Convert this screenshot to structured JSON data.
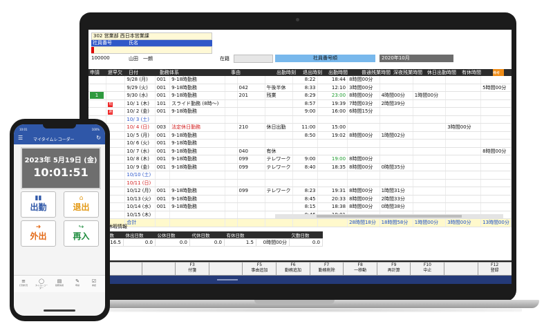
{
  "header": {
    "dept": "302 営業部 西日本営業課",
    "emp_no_label": "社員番号",
    "name_label": "氏名",
    "emp_no": "100000",
    "emp_name": "山田　一朗",
    "status_label": "在籍",
    "sort_button": "社員番号順",
    "month": "2020年10月"
  },
  "columns": {
    "shinsei": "申請",
    "chika": "遅早欠",
    "date": "日付",
    "kinmu": "勤務体系",
    "jiyu": "事由",
    "in": "出勤時刻",
    "out": "退出時刻",
    "work": "出勤時間",
    "ot": "普通残業時間",
    "late_ot": "深夜残業時間",
    "holiday": "休日出勤時間",
    "paid": "有休時間",
    "extra": "備考"
  },
  "rows": [
    {
      "tag": "",
      "red": "",
      "date": "9/28 (月)",
      "dc": "",
      "code": "001",
      "shift": "9-18時勤務",
      "sc": "",
      "rc": "",
      "reason": "",
      "in": "8:22",
      "out": "18:44",
      "oc": "",
      "work": "8時間00分",
      "ot": "",
      "late": "",
      "hol": "",
      "paid": ""
    },
    {
      "tag": "",
      "red": "",
      "date": "9/29 (火)",
      "dc": "",
      "code": "001",
      "shift": "9-18時勤務",
      "sc": "",
      "rc": "042",
      "reason": "午後半休",
      "in": "8:33",
      "out": "12:10",
      "oc": "",
      "work": "3時間00分",
      "ot": "",
      "late": "",
      "hol": "",
      "paid": "5時間00分"
    },
    {
      "tag": "1",
      "red": "",
      "date": "9/30 (水)",
      "dc": "",
      "code": "001",
      "shift": "9-18時勤務",
      "sc": "",
      "rc": "201",
      "reason": "残業",
      "in": "8:29",
      "out": "23:00",
      "oc": "green",
      "work": "8時間00分",
      "ot": "4時間00分",
      "late": "1時間00分",
      "hol": "",
      "paid": ""
    },
    {
      "tag": "",
      "red": "有",
      "date": "10/ 1 (木)",
      "dc": "",
      "code": "101",
      "shift": "スライド勤務 (8時～)",
      "sc": "",
      "rc": "",
      "reason": "",
      "in": "8:57",
      "out": "19:39",
      "oc": "",
      "work": "7時間03分",
      "ot": "2時間39分",
      "late": "",
      "hol": "",
      "paid": ""
    },
    {
      "tag": "",
      "red": "遅",
      "date": "10/ 2 (金)",
      "dc": "",
      "code": "001",
      "shift": "9-18時勤務",
      "sc": "",
      "rc": "",
      "reason": "",
      "in": "9:00",
      "out": "16:00",
      "oc": "",
      "work": "6時間15分",
      "ot": "",
      "late": "",
      "hol": "",
      "paid": ""
    },
    {
      "tag": "",
      "red": "",
      "date": "10/ 3 (土)",
      "dc": "sat",
      "code": "",
      "shift": "",
      "sc": "",
      "rc": "",
      "reason": "",
      "in": "",
      "out": "",
      "oc": "",
      "work": "",
      "ot": "",
      "late": "",
      "hol": "",
      "paid": ""
    },
    {
      "tag": "",
      "red": "",
      "date": "10/ 4 (日)",
      "dc": "sun",
      "code": "003",
      "shift": "法定休日勤務",
      "sc": "sun",
      "rc": "210",
      "reason": "休日出勤",
      "in": "11:00",
      "out": "15:00",
      "oc": "",
      "work": "",
      "ot": "",
      "late": "",
      "hol": "3時間00分",
      "paid": ""
    },
    {
      "tag": "",
      "red": "",
      "date": "10/ 5 (月)",
      "dc": "",
      "code": "001",
      "shift": "9-18時勤務",
      "sc": "",
      "rc": "",
      "reason": "",
      "in": "8:50",
      "out": "19:02",
      "oc": "",
      "work": "8時間00分",
      "ot": "1時間02分",
      "late": "",
      "hol": "",
      "paid": ""
    },
    {
      "tag": "",
      "red": "",
      "date": "10/ 6 (火)",
      "dc": "",
      "code": "001",
      "shift": "9-18時勤務",
      "sc": "",
      "rc": "",
      "reason": "",
      "in": "",
      "out": "",
      "oc": "",
      "work": "",
      "ot": "",
      "late": "",
      "hol": "",
      "paid": ""
    },
    {
      "tag": "",
      "red": "",
      "date": "10/ 7 (水)",
      "dc": "",
      "code": "001",
      "shift": "9-18時勤務",
      "sc": "",
      "rc": "040",
      "reason": "有休",
      "in": "",
      "out": "",
      "oc": "",
      "work": "",
      "ot": "",
      "late": "",
      "hol": "",
      "paid": "8時間00分"
    },
    {
      "tag": "",
      "red": "",
      "date": "10/ 8 (木)",
      "dc": "",
      "code": "001",
      "shift": "9-18時勤務",
      "sc": "",
      "rc": "099",
      "reason": "テレワーク",
      "in": "9:00",
      "out": "19:00",
      "oc": "green",
      "work": "8時間00分",
      "ot": "",
      "late": "",
      "hol": "",
      "paid": ""
    },
    {
      "tag": "",
      "red": "",
      "date": "10/ 9 (金)",
      "dc": "",
      "code": "001",
      "shift": "9-18時勤務",
      "sc": "",
      "rc": "099",
      "reason": "テレワーク",
      "in": "8:40",
      "out": "18:35",
      "oc": "",
      "work": "8時間00分",
      "ot": "0時間35分",
      "late": "",
      "hol": "",
      "paid": ""
    },
    {
      "tag": "",
      "red": "",
      "date": "10/10 (土)",
      "dc": "sat",
      "code": "",
      "shift": "",
      "sc": "",
      "rc": "",
      "reason": "",
      "in": "",
      "out": "",
      "oc": "",
      "work": "",
      "ot": "",
      "late": "",
      "hol": "",
      "paid": ""
    },
    {
      "tag": "",
      "red": "",
      "date": "10/11 (日)",
      "dc": "sun",
      "code": "",
      "shift": "",
      "sc": "",
      "rc": "",
      "reason": "",
      "in": "",
      "out": "",
      "oc": "",
      "work": "",
      "ot": "",
      "late": "",
      "hol": "",
      "paid": ""
    },
    {
      "tag": "",
      "red": "",
      "date": "10/12 (月)",
      "dc": "",
      "code": "001",
      "shift": "9-18時勤務",
      "sc": "",
      "rc": "099",
      "reason": "テレワーク",
      "in": "8:23",
      "out": "19:31",
      "oc": "",
      "work": "8時間00分",
      "ot": "1時間31分",
      "late": "",
      "hol": "",
      "paid": ""
    },
    {
      "tag": "",
      "red": "",
      "date": "10/13 (火)",
      "dc": "",
      "code": "001",
      "shift": "9-18時勤務",
      "sc": "",
      "rc": "",
      "reason": "",
      "in": "8:45",
      "out": "20:33",
      "oc": "",
      "work": "8時間00分",
      "ot": "2時間33分",
      "late": "",
      "hol": "",
      "paid": ""
    },
    {
      "tag": "",
      "red": "",
      "date": "10/14 (水)",
      "dc": "",
      "code": "001",
      "shift": "9-18時勤務",
      "sc": "",
      "rc": "",
      "reason": "",
      "in": "8:15",
      "out": "18:38",
      "oc": "",
      "work": "8時間00分",
      "ot": "0時間38分",
      "late": "",
      "hol": "",
      "paid": ""
    },
    {
      "tag": "",
      "red": "",
      "date": "10/15 (木)",
      "dc": "",
      "code": "",
      "shift": "",
      "sc": "",
      "rc": "",
      "reason": "",
      "in": "8:46",
      "out": "19:01",
      "oc": "",
      "work": "",
      "ot": "",
      "late": "",
      "hol": "",
      "paid": ""
    }
  ],
  "total": {
    "label": "合計",
    "work": "28時間18分",
    "ot": "18時間58分",
    "late": "1時間00分",
    "hol": "3時間00分",
    "paid": "13時間00分"
  },
  "kyuka": {
    "title": "法・休暇情報",
    "headers": [
      "出日数",
      "休出日数",
      "公休日数",
      "代休日数",
      "有休日数",
      "",
      "欠勤日数"
    ],
    "values": [
      "16.5",
      "0.0",
      "0.0",
      "0.0",
      "1.5",
      "0時間00分",
      "0.0"
    ]
  },
  "fkeys": [
    {
      "key": "",
      "label": ""
    },
    {
      "key": "",
      "label": ""
    },
    {
      "key": "F3",
      "label": "付箋"
    },
    {
      "key": "",
      "label": ""
    },
    {
      "key": "F5",
      "label": "事由追加"
    },
    {
      "key": "F6",
      "label": "勤務追加"
    },
    {
      "key": "F7",
      "label": "勤務削除"
    },
    {
      "key": "F8",
      "label": "一移動"
    },
    {
      "key": "F9",
      "label": "再計算"
    },
    {
      "key": "F10",
      "label": "中止"
    },
    {
      "key": "",
      "label": ""
    },
    {
      "key": "F12",
      "label": "登録"
    }
  ],
  "phone": {
    "time": "10:01",
    "battery": "100%",
    "app_title": "マイタイムレコーダー",
    "date": "2023年 5月19日 (金)",
    "clock": "10:01:51",
    "btn_in": "出勤",
    "btn_out": "退出",
    "btn_go": "外出",
    "btn_return": "再入",
    "nav": [
      "打刻状況",
      "タイムレコーダー",
      "勤務情報",
      "申請",
      "承認"
    ]
  },
  "colors": {
    "header_blue": "#3058c8",
    "sort_button_blue": "#78b8ec",
    "app_blue": "#2f57a8",
    "sunday_red": "#d21c1c",
    "saturday_blue": "#2a55c9",
    "green_time": "#1a9a2a"
  }
}
